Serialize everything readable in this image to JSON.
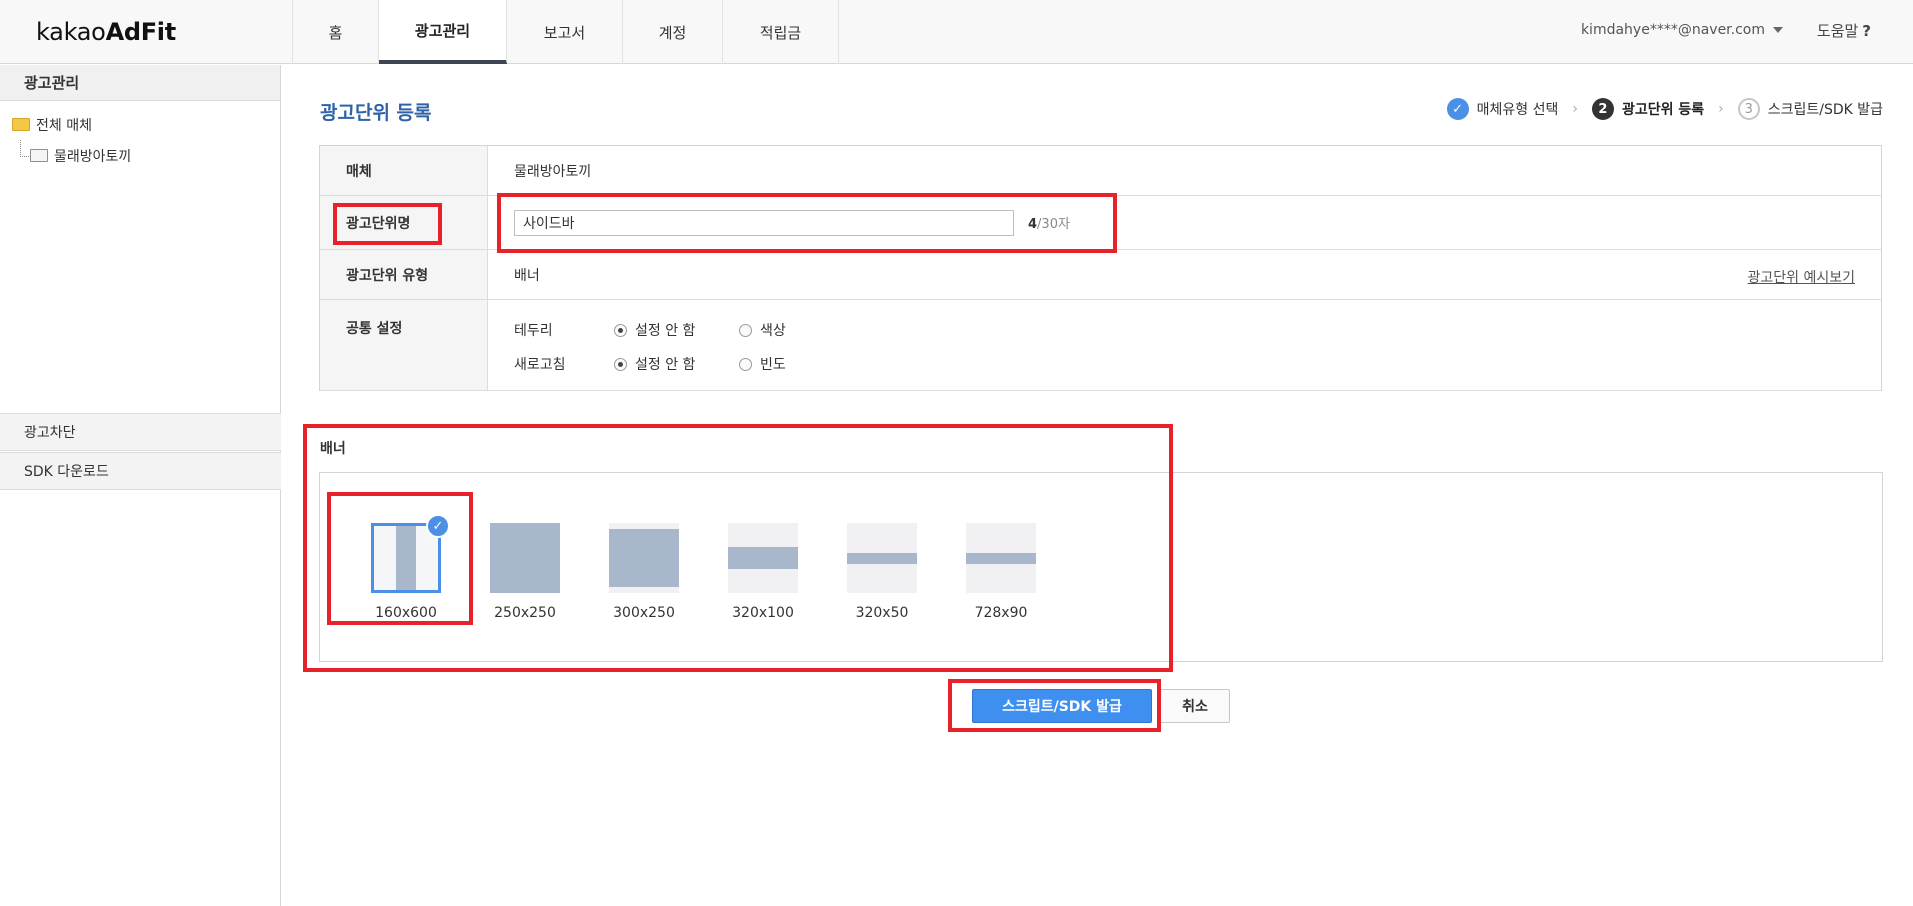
{
  "header": {
    "logo_light": "kakao",
    "logo_bold": "AdFit",
    "tabs": [
      {
        "label": "홈"
      },
      {
        "label": "광고관리"
      },
      {
        "label": "보고서"
      },
      {
        "label": "계정"
      },
      {
        "label": "적립금"
      }
    ],
    "active_tab": "광고관리",
    "user_email": "kimdahye****@naver.com",
    "help_label": "도움말",
    "help_mark": "?"
  },
  "sidebar": {
    "section_title": "광고관리",
    "tree_root": "전체 매체",
    "tree_child": "물래방아토끼",
    "section_block": "광고차단",
    "section_sdk": "SDK 다운로드"
  },
  "main": {
    "title": "광고단위 등록",
    "steps": [
      {
        "label": "매체유형 선택",
        "state": "done",
        "mark": "✓"
      },
      {
        "label": "광고단위 등록",
        "state": "current",
        "mark": "2"
      },
      {
        "label": "스크립트/SDK 발급",
        "state": "todo",
        "mark": "3"
      }
    ],
    "step_separator": "›",
    "form": {
      "media_label": "매체",
      "media_value": "물래방아토끼",
      "name_label": "광고단위명",
      "name_value": "사이드바",
      "name_count": "4",
      "name_max": "/30자",
      "type_label": "광고단위 유형",
      "type_value": "배너",
      "preview_link": "광고단위 예시보기",
      "common_label": "공통 설정",
      "border_label": "테두리",
      "border_opt1": "설정 안 함",
      "border_opt2": "색상",
      "refresh_label": "새로고침",
      "refresh_opt1": "설정 안 함",
      "refresh_opt2": "빈도"
    },
    "banner": {
      "title": "배너",
      "options": [
        {
          "label": "160x600",
          "selected": true
        },
        {
          "label": "250x250"
        },
        {
          "label": "300x250"
        },
        {
          "label": "320x100"
        },
        {
          "label": "320x50"
        },
        {
          "label": "728x90"
        }
      ],
      "check_mark": "✓"
    },
    "buttons": {
      "submit": "스크립트/SDK 발급",
      "cancel": "취소"
    }
  },
  "colors": {
    "accent": "#3e8ff0",
    "title_blue": "#2f62a8",
    "highlight_red": "#e8212b",
    "thumb_fill": "#a9b7cc"
  }
}
